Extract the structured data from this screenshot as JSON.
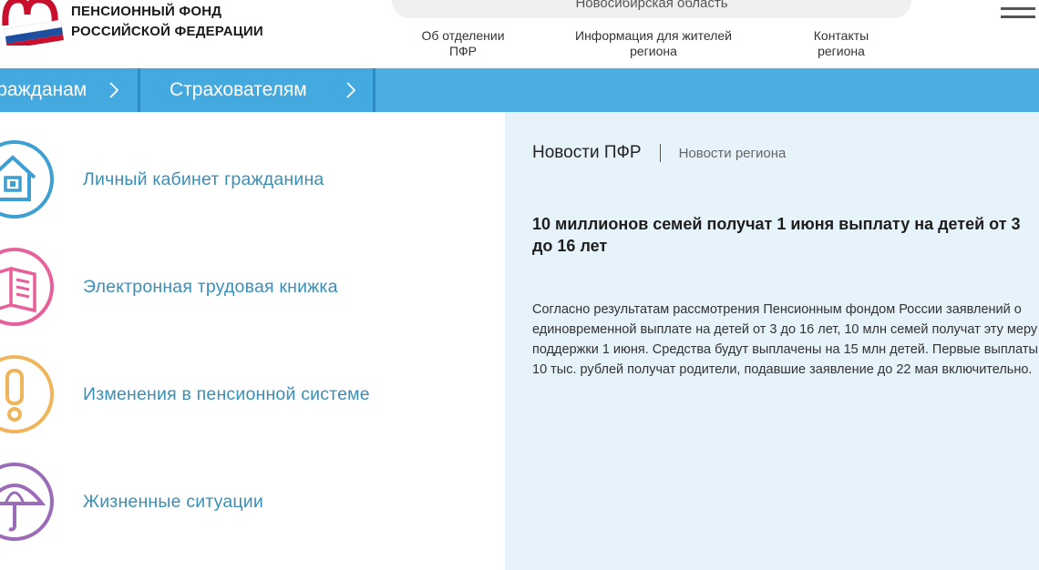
{
  "header": {
    "org_name_line1": "ПЕНСИОННЫЙ ФОНД",
    "org_name_line2": "РОССИЙСКОЙ ФЕДЕРАЦИИ",
    "region": "Новосибирская область",
    "nav": [
      {
        "line1": "Об отделении",
        "line2": "ПФР"
      },
      {
        "line1": "Информация для жителей",
        "line2": "региона"
      },
      {
        "line1": "Контакты",
        "line2": "региона"
      }
    ]
  },
  "navbar": {
    "items": [
      {
        "label": "Гражданам"
      },
      {
        "label": "Страхователям"
      }
    ]
  },
  "services": [
    {
      "label": "Личный кабинет гражданина",
      "icon": "house-icon",
      "color": "#3d9fd2"
    },
    {
      "label": "Электронная трудовая книжка",
      "icon": "book-icon",
      "color": "#e8609a"
    },
    {
      "label": "Изменения в пенсионной системе",
      "icon": "exclamation-icon",
      "color": "#f0b55a"
    },
    {
      "label": "Жизненные ситуации",
      "icon": "umbrella-icon",
      "color": "#9a6cb8"
    }
  ],
  "news": {
    "tab_active": "Новости ПФР",
    "tab_inactive": "Новости региона",
    "title": "10 миллионов семей получат 1 июня выплату на детей от 3 до 16 лет",
    "body": "Согласно результатам рассмотрения Пенсионным фондом России заявлений о единовременной выплате на детей от 3 до 16 лет, 10 млн семей получат эту меру поддержки 1 июня. Средства будут выплачены на 15 млн детей. Первые выплаты 10 тыс. рублей получат родители, подавшие заявление до 22 мая включительно."
  },
  "colors": {
    "navbar": "#4aaee0",
    "link": "#3a8fb7",
    "news_bg": "#e6f3fa"
  }
}
